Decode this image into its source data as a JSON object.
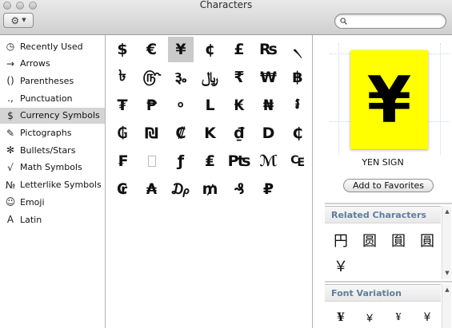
{
  "window": {
    "title": "Characters"
  },
  "toolbar": {
    "gear_icon": "gear-icon",
    "search_placeholder": ""
  },
  "categories": [
    {
      "icon": "◷",
      "label": "Recently Used",
      "selected": false
    },
    {
      "icon": "→",
      "label": "Arrows",
      "selected": false
    },
    {
      "icon": "()",
      "label": "Parentheses",
      "selected": false
    },
    {
      "icon": ".,",
      "label": "Punctuation",
      "selected": false
    },
    {
      "icon": "$",
      "label": "Currency Symbols",
      "selected": true
    },
    {
      "icon": "✎",
      "label": "Pictographs",
      "selected": false
    },
    {
      "icon": "✻",
      "label": "Bullets/Stars",
      "selected": false
    },
    {
      "icon": "√",
      "label": "Math Symbols",
      "selected": false
    },
    {
      "icon": "№",
      "label": "Letterlike Symbols",
      "selected": false
    },
    {
      "icon": "☺",
      "label": "Emoji",
      "selected": false
    },
    {
      "icon": "A",
      "label": "Latin",
      "selected": false
    }
  ],
  "grid": [
    [
      "$",
      "€",
      "¥",
      "¢",
      "£",
      "₨",
      "৲"
    ],
    [
      "৳",
      "௹",
      "૱",
      "﷼",
      "₹",
      "₩",
      "฿"
    ],
    [
      "₮",
      "₱",
      "৹",
      "L",
      "₭",
      "₦",
      "៛"
    ],
    [
      "₲",
      "₪",
      "₡",
      "K",
      "₫",
      "D",
      "₵"
    ],
    [
      "₣",
      "",
      "ƒ",
      "₤",
      "₧",
      "ℳ",
      "₠"
    ],
    [
      "₢",
      "₳",
      "₯",
      "₥",
      "₰",
      "₽"
    ]
  ],
  "selected_cell": {
    "row": 0,
    "col": 2
  },
  "preview": {
    "glyph": "¥",
    "name": "YEN SIGN",
    "add_favorites_label": "Add to Favorites"
  },
  "related": {
    "title": "Related Characters",
    "chars": [
      "円",
      "圆",
      "圎",
      "圓",
      "￥"
    ]
  },
  "font_variation": {
    "title": "Font Variation",
    "chars": [
      "¥",
      "¥",
      "¥",
      "¥"
    ]
  }
}
